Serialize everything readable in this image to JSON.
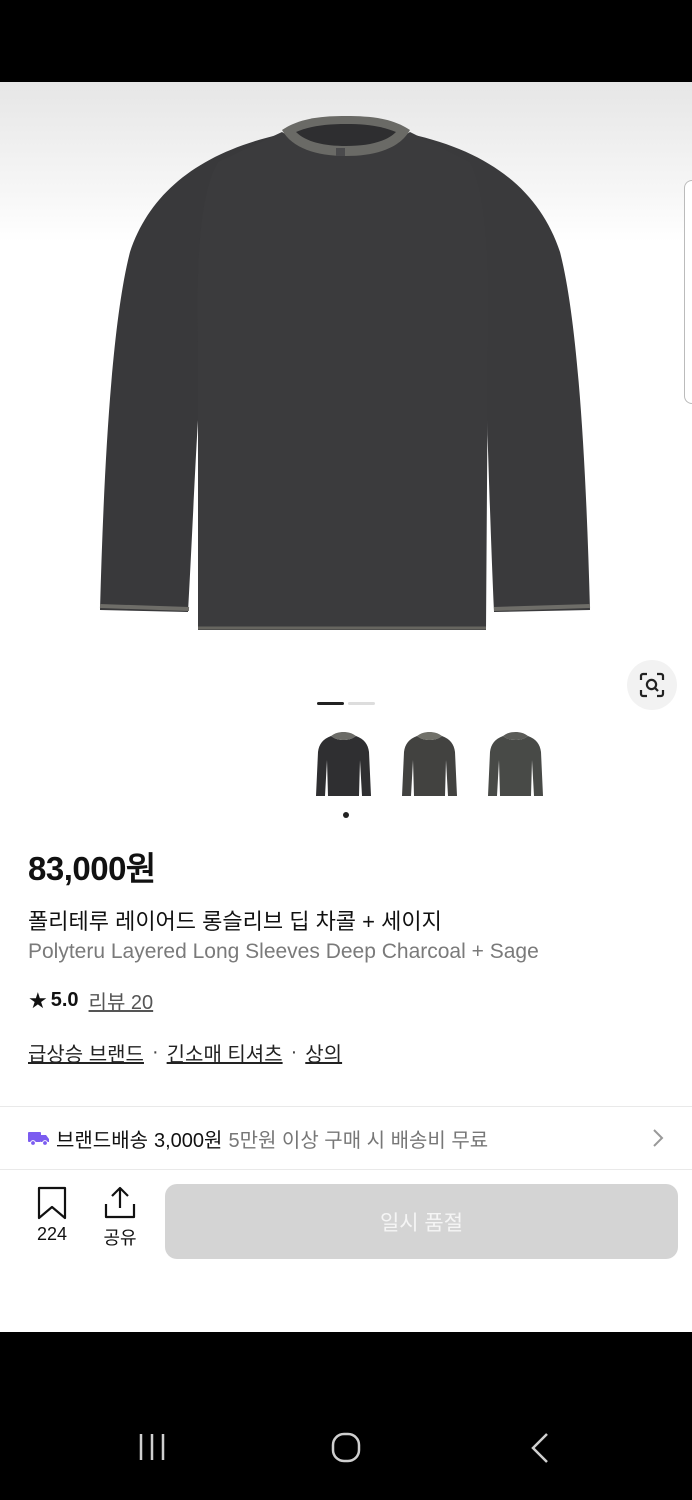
{
  "product": {
    "price": "83,000원",
    "title_ko": "폴리테루 레이어드 롱슬리브 딥 차콜 + 세이지",
    "title_en": "Polyteru Layered Long Sleeves Deep Charcoal + Sage",
    "rating_score": "5.0",
    "review_link": "리뷰 20",
    "image_index": 1,
    "image_count": 2
  },
  "categories": [
    {
      "label": "급상승 브랜드"
    },
    {
      "label": "긴소매 티셔츠"
    },
    {
      "label": "상의"
    }
  ],
  "category_separator": "·",
  "shipping": {
    "label": "브랜드배송",
    "cost": "3,000원",
    "note": "5만원 이상 구매 시 배송비 무료"
  },
  "actions": {
    "bookmark_count": "224",
    "share_label": "공유",
    "buy_button": "일시 품절"
  },
  "icons": {
    "lens": "visual-search-icon",
    "bookmark": "bookmark-icon",
    "share": "share-icon",
    "truck": "truck-icon",
    "chevron": "chevron-right-icon",
    "star": "star-icon"
  },
  "colors": {
    "shirt_body": "#3a3a3c",
    "trim": "#6b6b66",
    "truck": "#7b5cf0",
    "soldout_bg": "#d4d4d4"
  }
}
